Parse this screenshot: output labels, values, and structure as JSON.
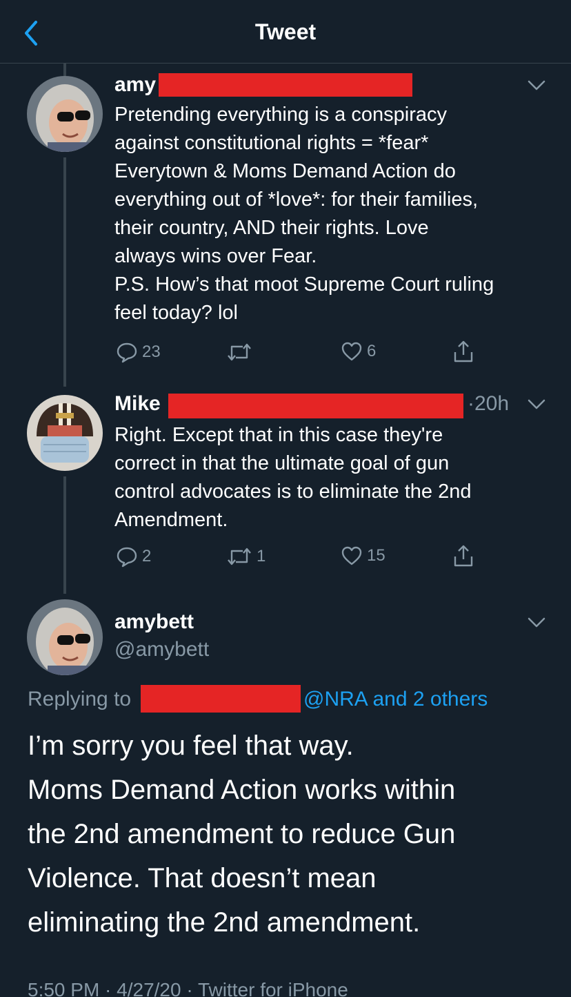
{
  "header": {
    "title": "Tweet"
  },
  "tweets": [
    {
      "name": "amy",
      "text": "Pretending everything is a conspiracy\nagainst constitutional rights = *fear*\nEverytown & Moms Demand Action do\neverything out of *love*: for their families,\ntheir country, AND their rights. Love\nalways wins over Fear.\nP.S. How’s that moot Supreme Court ruling\nfeel today? lol",
      "replies": "23",
      "retweets": "",
      "likes": "6"
    },
    {
      "name": "Mike",
      "time": "·20h",
      "text": "Right. Except that in this case they're\ncorrect in that the ultimate goal of gun\ncontrol advocates is to eliminate the 2nd\nAmendment.",
      "replies": "2",
      "retweets": "1",
      "likes": "15"
    }
  ],
  "main_tweet": {
    "name": "amybett",
    "handle": "@amybett",
    "replying_prefix": "Replying to",
    "replying_link": "@NRA and 2 others",
    "text": "I’m sorry you feel that way.\nMoms Demand Action works within\nthe 2nd amendment to reduce Gun\nViolence. That doesn’t mean\neliminating the 2nd amendment.",
    "footer": "5:50 PM · 4/27/20 · Twitter for iPhone"
  },
  "colors": {
    "background": "#15202b",
    "accent": "#1da1f2",
    "muted": "#8899a6",
    "redaction": "#e52525"
  },
  "icons": [
    "back-chevron-icon",
    "chevron-down-icon",
    "reply-icon",
    "retweet-icon",
    "like-icon",
    "share-icon"
  ]
}
